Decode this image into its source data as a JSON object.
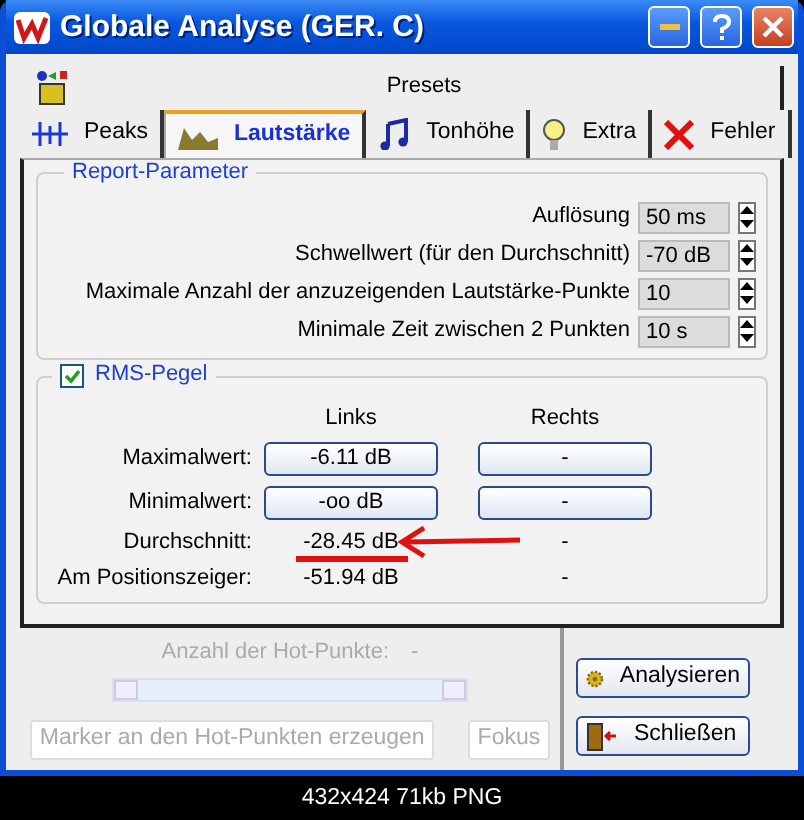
{
  "window": {
    "title": "Globale Analyse (GER. C)"
  },
  "presets": {
    "label": "Presets"
  },
  "tabs": [
    {
      "label": "Peaks",
      "kind": "peaks",
      "selected": false
    },
    {
      "label": "Lautstärke",
      "kind": "volume",
      "selected": true
    },
    {
      "label": "Tonhöhe",
      "kind": "notes",
      "selected": false
    },
    {
      "label": "Extra",
      "kind": "bulb",
      "selected": false
    },
    {
      "label": "Fehler",
      "kind": "cross",
      "selected": false
    }
  ],
  "report_parameter": {
    "title": "Report-Parameter",
    "fields": [
      {
        "label": "Auflösung",
        "value": "50 ms"
      },
      {
        "label": "Schwellwert (für den Durchschnitt)",
        "value": "-70 dB"
      },
      {
        "label": "Maximale Anzahl der anzuzeigenden Lautstärke-Punkte",
        "value": "10"
      },
      {
        "label": "Minimale Zeit zwischen 2 Punkten",
        "value": "10 s"
      }
    ]
  },
  "rms": {
    "title": "RMS-Pegel",
    "checked": true,
    "columns": [
      "Links",
      "Rechts"
    ],
    "rows": [
      {
        "label": "Maximalwert:",
        "kind": "button",
        "links": "-6.11 dB",
        "rechts": "-",
        "marked": false
      },
      {
        "label": "Minimalwert:",
        "kind": "button",
        "links": "-oo dB",
        "rechts": "-",
        "marked": false
      },
      {
        "label": "Durchschnitt:",
        "kind": "text",
        "links": "-28.45 dB",
        "rechts": "-",
        "marked": true
      },
      {
        "label": "Am Positionszeiger:",
        "kind": "text",
        "links": "-51.94 dB",
        "rechts": "-",
        "marked": false
      }
    ]
  },
  "hot_points": {
    "label": "Anzahl der Hot-Punkte:",
    "value": "-",
    "disabled": true
  },
  "action_buttons": [
    {
      "label": "Marker an den Hot-Punkten erzeugen",
      "disabled": true
    },
    {
      "label": "Fokus",
      "disabled": true
    }
  ],
  "side_buttons": [
    {
      "label": "Analysieren",
      "kind": "gear"
    },
    {
      "label": "Schließen",
      "kind": "door"
    }
  ],
  "caption": "432x424 71kb PNG"
}
